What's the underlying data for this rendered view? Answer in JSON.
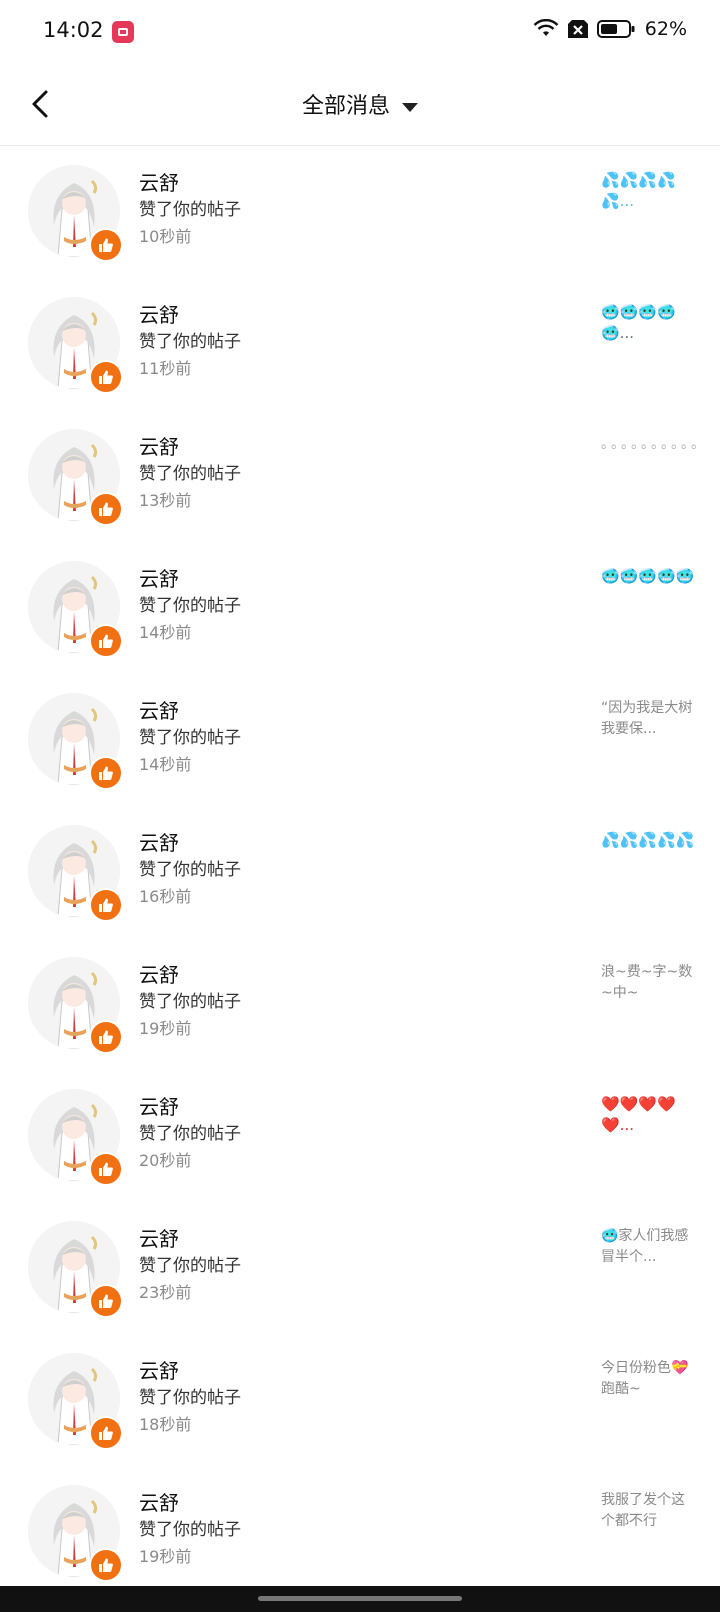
{
  "status_bar": {
    "time": "14:02",
    "battery_percent": "62%",
    "battery_level": 0.62,
    "icons": [
      "screen-record-icon",
      "wifi-icon",
      "sim-off-icon",
      "battery-icon"
    ]
  },
  "header": {
    "title": "全部消息",
    "back_icon": "chevron-left-icon",
    "dropdown_icon": "caret-down-icon"
  },
  "colors": {
    "like_badge": "#f07012",
    "record_badge": "#e5395a",
    "divider": "#e6e6e6",
    "muted_text": "#8a8a8a"
  },
  "notifications": [
    {
      "name": "云舒",
      "action": "赞了你的帖子",
      "time": "10秒前",
      "preview": "💦💦💦💦💦...",
      "preview_kind": "sweat"
    },
    {
      "name": "云舒",
      "action": "赞了你的帖子",
      "time": "11秒前",
      "preview": "🥶🥶🥶🥶🥶...",
      "preview_kind": "cold"
    },
    {
      "name": "云舒",
      "action": "赞了你的帖子",
      "time": "13秒前",
      "preview": "。。。。。。。。。。...",
      "preview_kind": "dots"
    },
    {
      "name": "云舒",
      "action": "赞了你的帖子",
      "time": "14秒前",
      "preview": "🥶🥶🥶🥶🥶",
      "preview_kind": "cold"
    },
    {
      "name": "云舒",
      "action": "赞了你的帖子",
      "time": "14秒前",
      "preview": "“因为我是大树我要保...",
      "preview_kind": "text"
    },
    {
      "name": "云舒",
      "action": "赞了你的帖子",
      "time": "16秒前",
      "preview": "💦💦💦💦💦",
      "preview_kind": "sweat"
    },
    {
      "name": "云舒",
      "action": "赞了你的帖子",
      "time": "19秒前",
      "preview": "浪~费~字~数~中~",
      "preview_kind": "text"
    },
    {
      "name": "云舒",
      "action": "赞了你的帖子",
      "time": "20秒前",
      "preview": "❤️❤️❤️❤️❤️...",
      "preview_kind": "hearts"
    },
    {
      "name": "云舒",
      "action": "赞了你的帖子",
      "time": "23秒前",
      "preview": "🥶家人们我感冒半个...",
      "preview_kind": "text"
    },
    {
      "name": "云舒",
      "action": "赞了你的帖子",
      "time": "18秒前",
      "preview": "今日份粉色💝跑酷~",
      "preview_kind": "text"
    },
    {
      "name": "云舒",
      "action": "赞了你的帖子",
      "time": "19秒前",
      "preview": "我服了发个这个都不行",
      "preview_kind": "text"
    }
  ]
}
